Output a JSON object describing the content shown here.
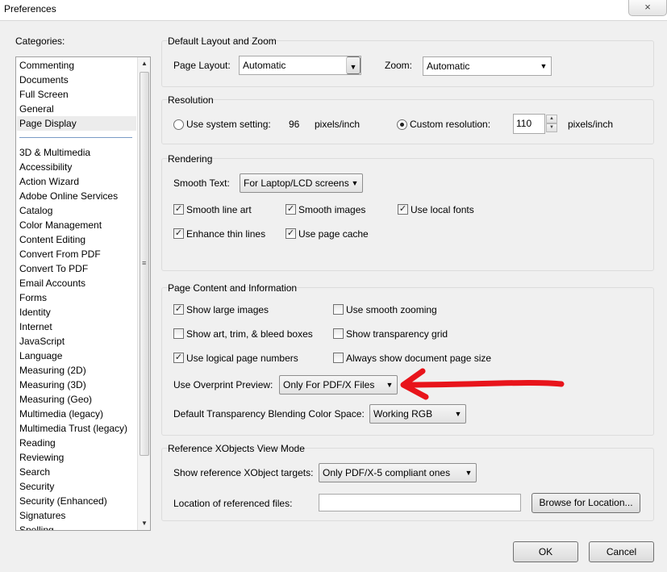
{
  "window": {
    "title": "Preferences",
    "close_icon": "×"
  },
  "categories": {
    "label": "Categories:",
    "top_items": [
      "Commenting",
      "Documents",
      "Full Screen",
      "General",
      "Page Display"
    ],
    "selected": "Page Display",
    "items": [
      "3D & Multimedia",
      "Accessibility",
      "Action Wizard",
      "Adobe Online Services",
      "Catalog",
      "Color Management",
      "Content Editing",
      "Convert From PDF",
      "Convert To PDF",
      "Email Accounts",
      "Forms",
      "Identity",
      "Internet",
      "JavaScript",
      "Language",
      "Measuring (2D)",
      "Measuring (3D)",
      "Measuring (Geo)",
      "Multimedia (legacy)",
      "Multimedia Trust (legacy)",
      "Reading",
      "Reviewing",
      "Search",
      "Security",
      "Security (Enhanced)",
      "Signatures",
      "Spelling"
    ]
  },
  "layout_zoom": {
    "title": "Default Layout and Zoom",
    "page_layout_label": "Page Layout:",
    "page_layout_value": "Automatic",
    "zoom_label": "Zoom:",
    "zoom_value": "Automatic"
  },
  "resolution": {
    "title": "Resolution",
    "system_label": "Use system setting:",
    "system_value": "96",
    "system_unit": "pixels/inch",
    "custom_label": "Custom resolution:",
    "custom_value": "110",
    "custom_unit": "pixels/inch",
    "selected": "custom"
  },
  "rendering": {
    "title": "Rendering",
    "smooth_text_label": "Smooth Text:",
    "smooth_text_value": "For Laptop/LCD screens",
    "smooth_line_art": "Smooth line art",
    "smooth_images": "Smooth images",
    "use_local_fonts": "Use local fonts",
    "enhance_thin_lines": "Enhance thin lines",
    "use_page_cache": "Use page cache",
    "checked": {
      "smooth_line_art": true,
      "smooth_images": true,
      "use_local_fonts": true,
      "enhance_thin_lines": true,
      "use_page_cache": true
    }
  },
  "page_content": {
    "title": "Page Content and Information",
    "show_large_images": "Show large images",
    "use_smooth_zooming": "Use smooth zooming",
    "show_art_trim": "Show art, trim, & bleed boxes",
    "show_transparency_grid": "Show transparency grid",
    "use_logical_page_numbers": "Use logical page numbers",
    "always_show_doc_page_size": "Always show document page size",
    "checked": {
      "show_large_images": true,
      "use_smooth_zooming": false,
      "show_art_trim": false,
      "show_transparency_grid": false,
      "use_logical_page_numbers": true,
      "always_show_doc_page_size": false
    },
    "overprint_label": "Use Overprint Preview:",
    "overprint_value": "Only For PDF/X Files",
    "blending_label": "Default Transparency Blending Color Space:",
    "blending_value": "Working RGB"
  },
  "xobjects": {
    "title": "Reference XObjects View Mode",
    "show_targets_label": "Show reference XObject targets:",
    "show_targets_value": "Only PDF/X-5 compliant ones",
    "location_label": "Location of referenced files:",
    "location_value": "",
    "browse_label": "Browse for Location..."
  },
  "footer": {
    "ok_label": "OK",
    "cancel_label": "Cancel"
  },
  "annotation": {
    "arrow_color": "#e8141b"
  },
  "icons": {
    "dropdown": "▼",
    "check": "✓",
    "scroll_up": "▲",
    "scroll_down": "▼",
    "spin_up": "▲",
    "spin_down": "▼",
    "grip": "≡"
  }
}
